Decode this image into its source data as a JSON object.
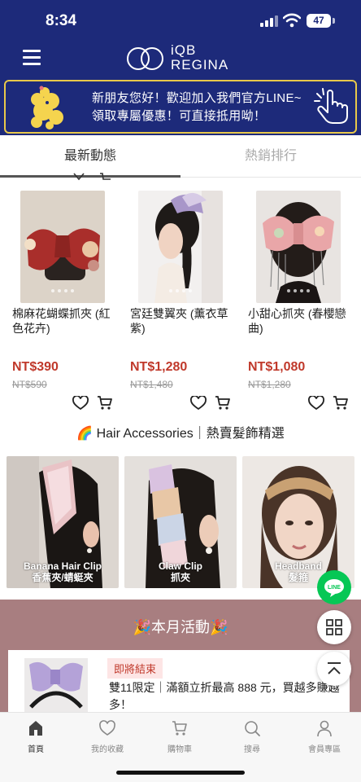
{
  "status": {
    "time": "8:34",
    "battery": "47"
  },
  "brand": {
    "line1": "iQB",
    "line2": "REGINA"
  },
  "banner": {
    "line1": "新朋友您好！歡迎加入我們官方LINE~",
    "line2": "領取專屬優惠！可直接抵用呦！"
  },
  "tabs": [
    {
      "label": "最新動態"
    },
    {
      "label": "熱銷排行"
    }
  ],
  "products": [
    {
      "name": "棉麻花蝴蝶抓夾 (紅色花卉)",
      "price": "NT$390",
      "original_price": "NT$590"
    },
    {
      "name": "宮廷雙翼夾 (薰衣草紫)",
      "price": "NT$1,280",
      "original_price": "NT$1,480"
    },
    {
      "name": "小甜心抓夾 (春櫻戀曲)",
      "price": "NT$1,080",
      "original_price": "NT$1,280"
    }
  ],
  "hair_section": {
    "title": "🌈 Hair Accessories｜熱賣髮飾精選"
  },
  "categories": [
    {
      "en": "Banana Hair Clip",
      "zh": "香蕉夾/蜻蜓夾"
    },
    {
      "en": "Claw Clip",
      "zh": "抓夾"
    },
    {
      "en": "Headband",
      "zh": "髮箍"
    }
  ],
  "activity": {
    "title": "🎉本月活動🎉",
    "badge": "即將結束",
    "text": "雙11限定｜滿額立折最高 888 元，買越多賺越多！"
  },
  "floating": {
    "line_label": "LINE"
  },
  "bottom_nav": [
    {
      "label": "首頁",
      "icon": "home-icon"
    },
    {
      "label": "我的收藏",
      "icon": "heart-icon"
    },
    {
      "label": "購物車",
      "icon": "cart-icon"
    },
    {
      "label": "搜尋",
      "icon": "search-icon"
    },
    {
      "label": "會員專區",
      "icon": "user-icon"
    }
  ],
  "colors": {
    "brand_navy": "#1d2a7a",
    "banner_border": "#e8c84a",
    "price_red": "#c0392b",
    "activity_bg": "#a87e80",
    "line_green": "#06c755"
  }
}
